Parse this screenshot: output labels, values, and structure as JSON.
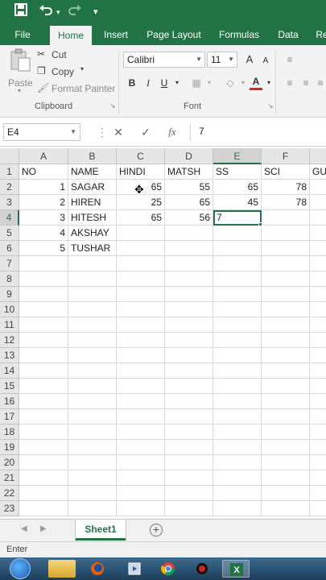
{
  "app": {
    "accent": "#217346"
  },
  "quick_access": {
    "save_icon": "save-icon",
    "undo_icon": "undo-icon",
    "redo_icon": "redo-icon",
    "customize_icon": "customize-qat-icon"
  },
  "ribbon": {
    "tabs": [
      "File",
      "Home",
      "Insert",
      "Page Layout",
      "Formulas",
      "Data",
      "Re"
    ],
    "active_tab": "Home",
    "clipboard": {
      "paste_label": "Paste",
      "cut_label": "Cut",
      "copy_label": "Copy",
      "format_painter_label": "Format Painter",
      "group_label": "Clipboard"
    },
    "font": {
      "font_name": "Calibri",
      "font_size": "11",
      "bold": "B",
      "italic": "I",
      "underline": "U",
      "increase_size": "A",
      "decrease_size": "A",
      "font_color_letter": "A",
      "group_label": "Font"
    }
  },
  "formula_bar": {
    "name_box": "E4",
    "cancel_icon": "cancel-icon",
    "enter_icon": "checkmark-icon",
    "fx_label": "fx",
    "value": "7"
  },
  "sheet": {
    "columns": [
      "A",
      "B",
      "C",
      "D",
      "E",
      "F",
      "G"
    ],
    "rows": [
      "1",
      "2",
      "3",
      "4",
      "5",
      "6",
      "7",
      "8",
      "9",
      "10",
      "11",
      "12",
      "13",
      "14",
      "15",
      "16",
      "17",
      "18",
      "19",
      "20",
      "21",
      "22",
      "23"
    ],
    "cells": {
      "A1": "NO",
      "B1": "NAME",
      "C1": "HINDI",
      "D1": "MATSH",
      "E1": "SS",
      "F1": "SCI",
      "G1": "GU",
      "A2": "1",
      "B2": "SAGAR",
      "C2": "65",
      "D2": "55",
      "E2": "65",
      "F2": "78",
      "A3": "2",
      "B3": "HIREN",
      "C3": "25",
      "D3": "65",
      "E3": "45",
      "F3": "78",
      "A4": "3",
      "B4": "HITESH",
      "C4": "65",
      "D4": "56",
      "E4": "7",
      "A5": "4",
      "B5": "AKSHAY",
      "A6": "5",
      "B6": "TUSHAR"
    },
    "active_cell": "E4"
  },
  "sheet_tabs": {
    "tabs": [
      "Sheet1"
    ],
    "active": "Sheet1"
  },
  "status_bar": {
    "mode": "Enter"
  },
  "taskbar": {
    "items": [
      "start-icon",
      "file-explorer-icon",
      "firefox-icon",
      "media-player-icon",
      "chrome-icon",
      "record-icon",
      "excel-icon"
    ]
  }
}
